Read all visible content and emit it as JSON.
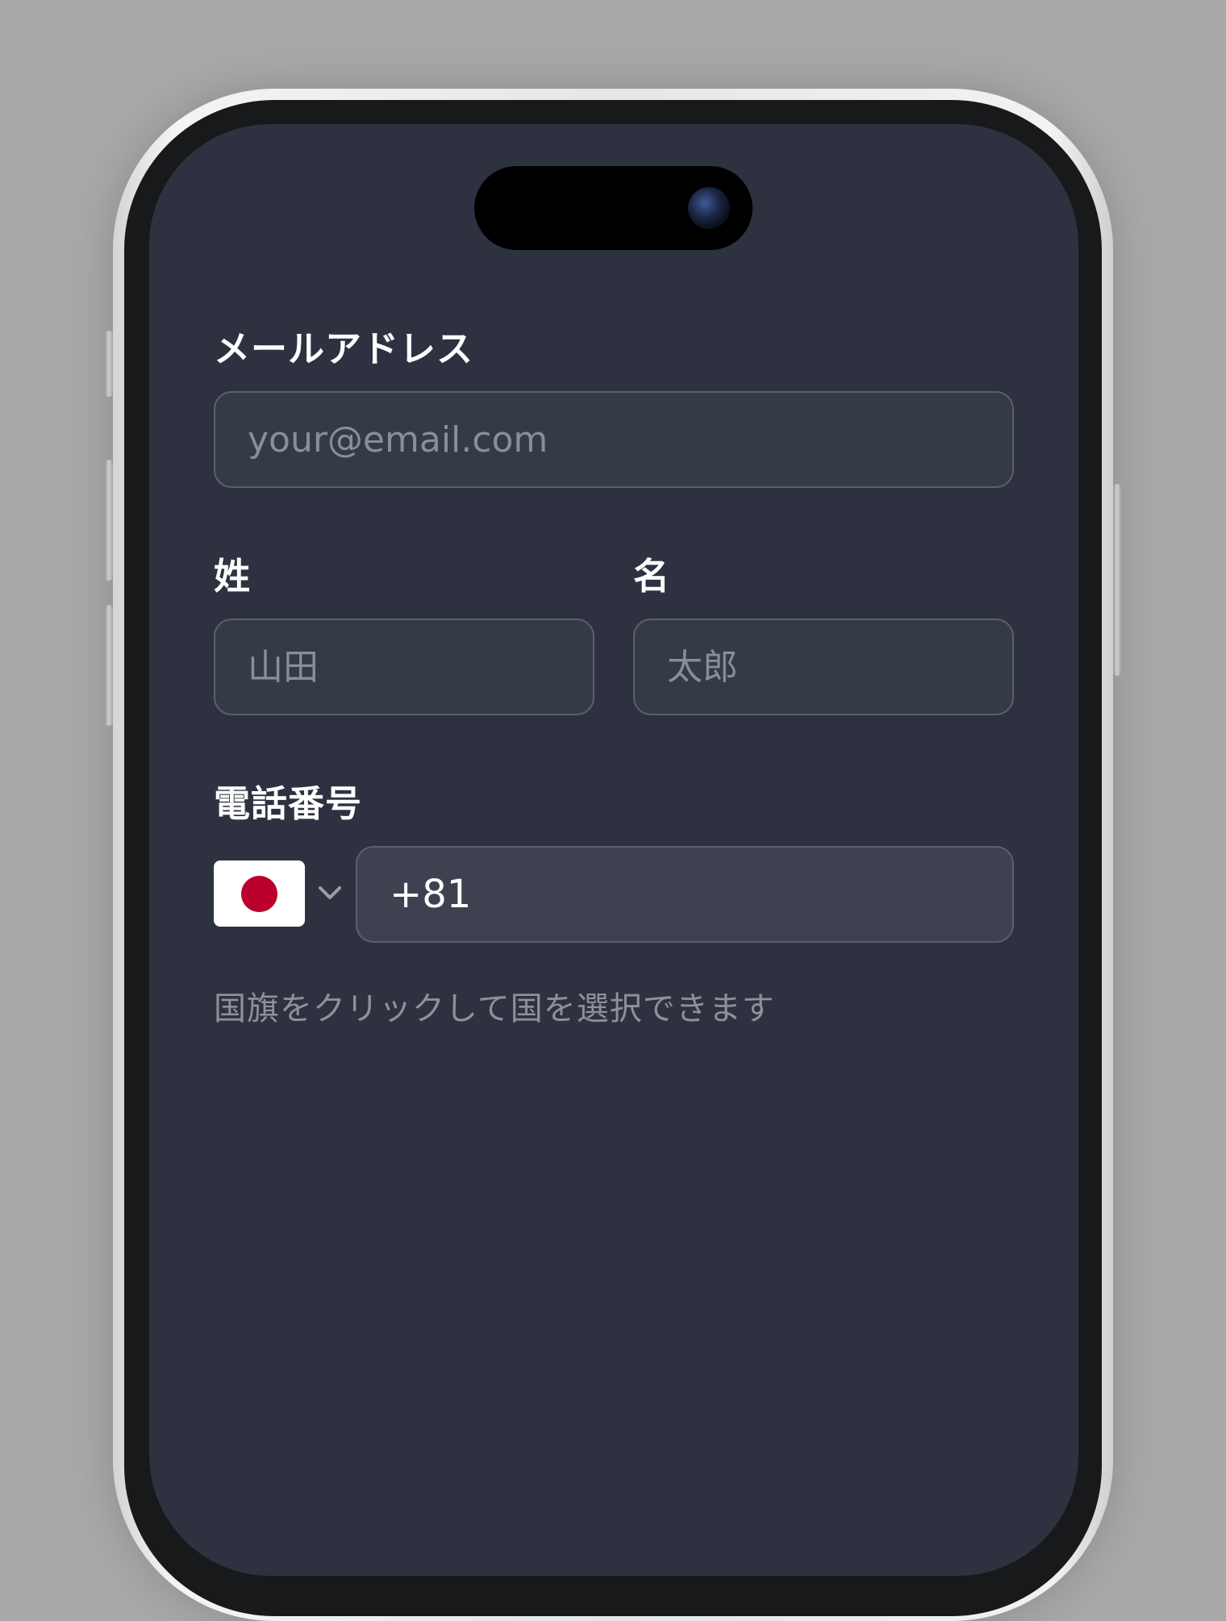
{
  "form": {
    "email": {
      "label": "メールアドレス",
      "placeholder": "your@email.com",
      "value": ""
    },
    "last_name": {
      "label": "姓",
      "placeholder": "山田",
      "value": ""
    },
    "first_name": {
      "label": "名",
      "placeholder": "太郎",
      "value": ""
    },
    "phone": {
      "label": "電話番号",
      "country": "Japan",
      "flag_icon": "japan-flag-icon",
      "flag_colors": {
        "field": "#ffffff",
        "disc": "#bc002d"
      },
      "value": "+81"
    },
    "helper_text": "国旗をクリックして国を選択できます"
  },
  "theme": {
    "screen_background": "#2e3240",
    "input_background": "#353a47",
    "input_border": "#5b606e",
    "label_color": "#ffffff",
    "placeholder_color": "#8a8e99",
    "helper_color": "#8d919c"
  }
}
